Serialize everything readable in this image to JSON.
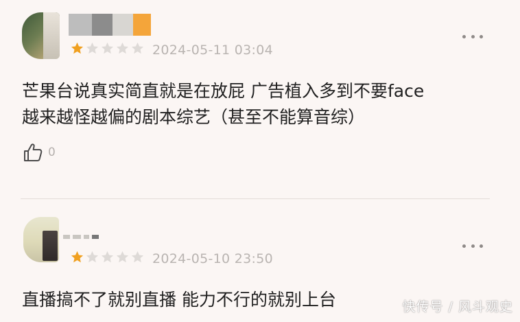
{
  "colors": {
    "background": "#fbf6f4",
    "star_filled": "#f0a020",
    "star_empty": "#dedad7",
    "date_text": "#b9b4b1",
    "divider": "#e3dcd8"
  },
  "reviews": [
    {
      "rating": 1,
      "max_rating": 5,
      "date": "2024-05-11 03:04",
      "comment_lines": [
        "芒果台说真实简直就是在放屁 广告植入多到不要face",
        "越来越怪越偏的剧本综艺（甚至不能算音综）"
      ],
      "like_icon": "thumbs-up-icon",
      "like_count": "0",
      "more_icon": "more-dots-icon"
    },
    {
      "rating": 1,
      "max_rating": 5,
      "date": "2024-05-10 23:50",
      "comment_lines": [
        "直播搞不了就别直播 能力不行的就别上台"
      ],
      "more_icon": "more-dots-icon"
    }
  ],
  "watermark": "快传号 / 风斗观史"
}
